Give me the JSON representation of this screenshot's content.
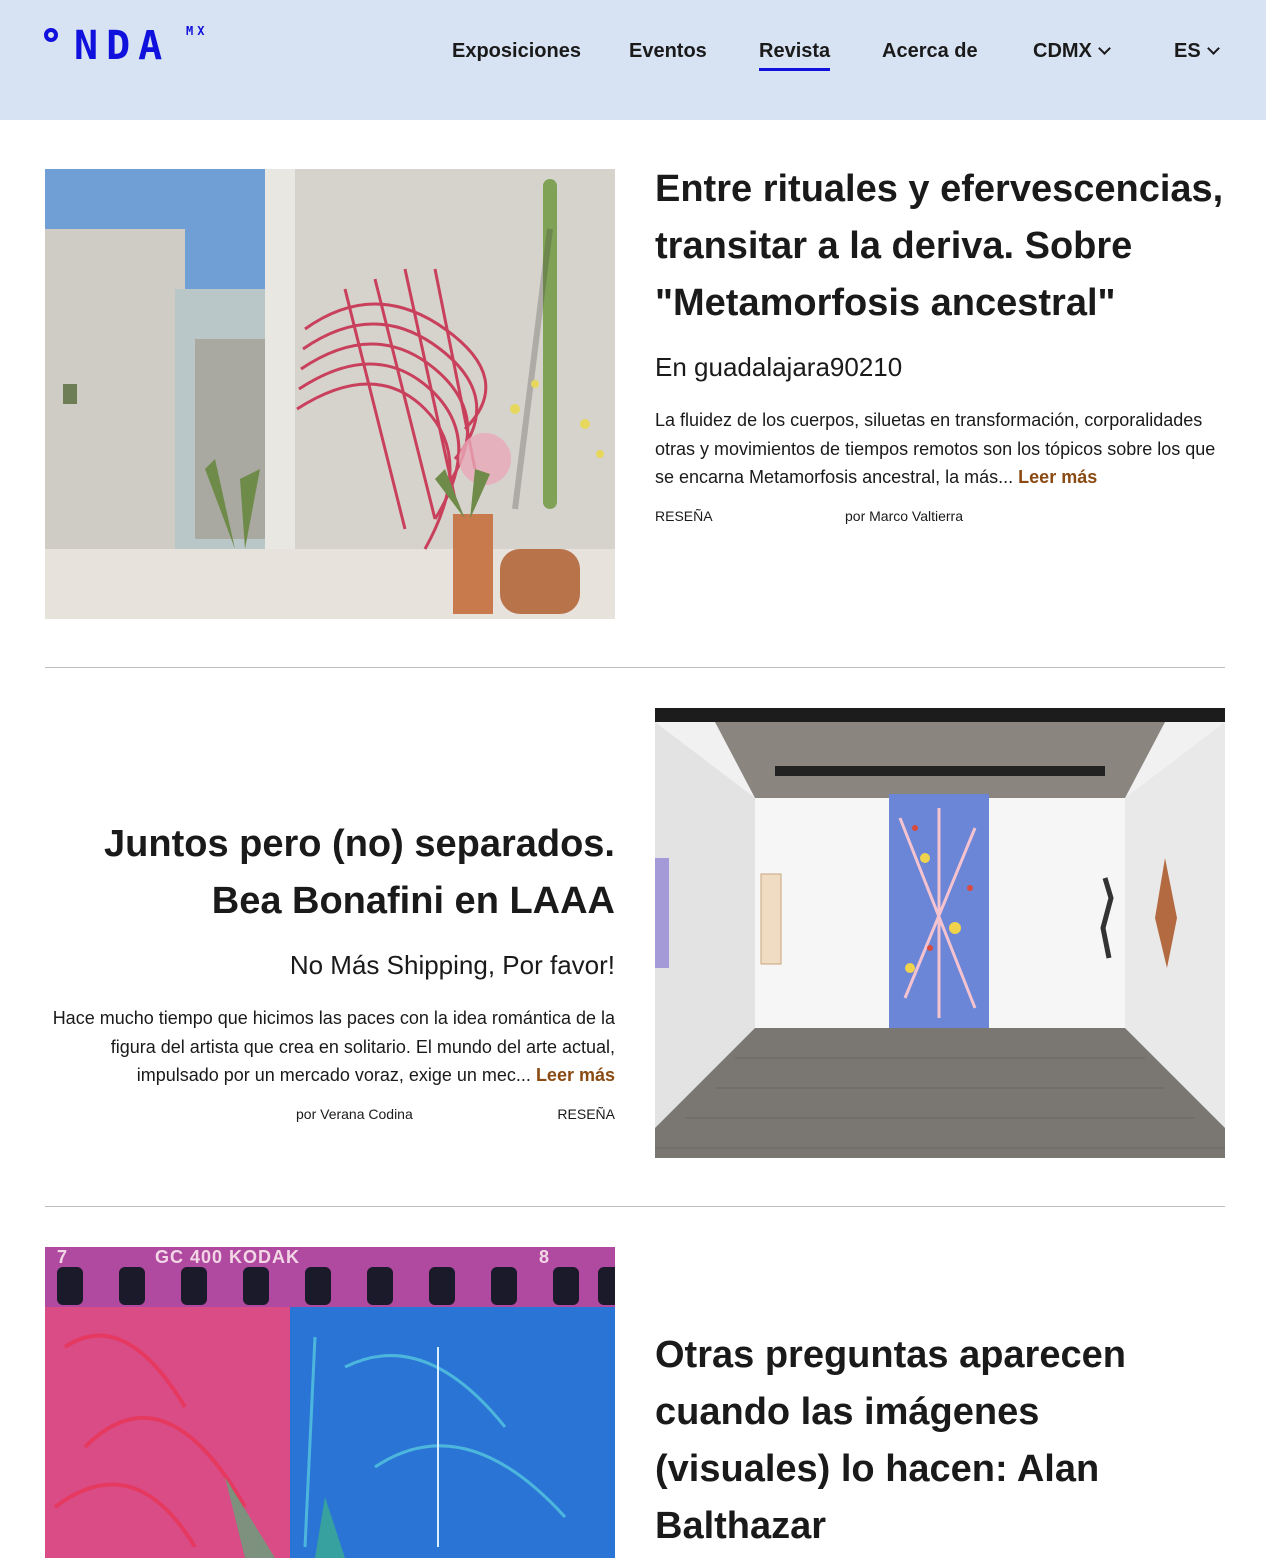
{
  "brand": {
    "logo_letters": "NDA",
    "logo_sub": "MX"
  },
  "nav": {
    "exposiciones": "Exposiciones",
    "eventos": "Eventos",
    "revista": "Revista",
    "acerca": "Acerca de",
    "city": "CDMX",
    "lang": "ES"
  },
  "articles": [
    {
      "title": "Entre rituales y efervescencias, transitar a la deriva. Sobre \"Metamorfosis ancestral\"",
      "venue": "En guadalajara90210",
      "excerpt": "La fluidez de los cuerpos, siluetas en transformación, corporalidades otras y movimientos de tiempos remotos son los tópicos sobre los que se encarna Metamorfosis ancestral, la más...",
      "more": "Leer más",
      "category": "RESEÑA",
      "author": "por Marco Valtierra"
    },
    {
      "title": "Juntos pero (no) separados. Bea Bonafini en LAAA",
      "venue": "No Más Shipping, Por favor!",
      "excerpt": "Hace mucho tiempo que hicimos las paces con la idea romántica de la figura del artista que crea en solitario. El mundo del arte actual, impulsado por un mercado voraz, exige un mec...",
      "more": "Leer más",
      "category": "RESEÑA",
      "author": "por Verana Codina"
    },
    {
      "title": "Otras preguntas aparecen cuando las imágenes (visuales) lo hacen: Alan Balthazar",
      "film_text": "GC 400 KODAK",
      "film_num_left": "7",
      "film_num_right": "8"
    }
  ]
}
